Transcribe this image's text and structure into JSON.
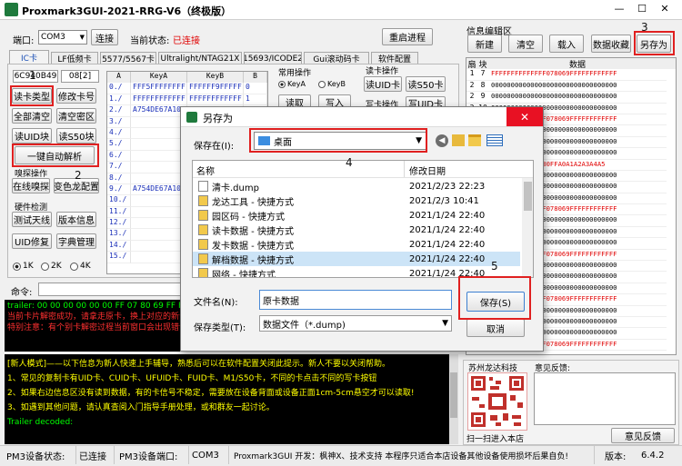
{
  "window": {
    "title": "Proxmark3GUI-2021-RRG-V6（终极版）",
    "min": "—",
    "max": "☐",
    "close": "✕"
  },
  "toolbar": {
    "port_label": "端口:",
    "port_value": "COM3",
    "connect": "连接",
    "state_label": "当前状态:",
    "state_value": "已连接",
    "restart": "重启进程"
  },
  "tabs": [
    "IC卡",
    "LF低频卡",
    "5577/5567卡",
    "Ultralight/NTAG21X",
    "15693/ICODE2",
    "Gui滚动码卡",
    "软件配置"
  ],
  "ic": {
    "uid": "6C940B49",
    "sak": "08[2]",
    "btn_read_type": "读卡类型",
    "btn_modify": "修改卡号",
    "btn_clear_all": "全部清空",
    "btn_clear_key": "清空密区",
    "btn_read_uid": "读UID块",
    "btn_read_s50": "读S50块",
    "btn_auto_parse": "一键自动解析",
    "sec_sniff": "嗅探操作",
    "btn_online_sniff": "在线嗅探",
    "btn_chameleon": "变色龙配置",
    "sec_hw": "硬件检测",
    "btn_test_antenna": "测试天线",
    "btn_version": "版本信息",
    "btn_uid_fix": "UID修复",
    "btn_dict": "字典管理",
    "radio_1k": "1K",
    "radio_2k": "2K",
    "radio_4k": "4K"
  },
  "keys_table": {
    "headers": [
      "A",
      "KeyA",
      "KeyB",
      "B"
    ],
    "rows": [
      [
        "0./",
        "FFF5FFFFFFFF",
        "FFFFFF9FFFFF",
        "0"
      ],
      [
        "1./",
        "FFFFFFFFFFFF",
        "FFFFFFFFFFFF",
        "1"
      ],
      [
        "2./",
        "A754DE67A10",
        "",
        "2"
      ],
      [
        "3./",
        "",
        "",
        "3"
      ],
      [
        "4./",
        "",
        "",
        "4"
      ],
      [
        "5./",
        "",
        "",
        "5"
      ],
      [
        "6./",
        "",
        "",
        "6"
      ],
      [
        "7./",
        "",
        "",
        "7"
      ],
      [
        "8./",
        "",
        "",
        "8"
      ],
      [
        "9./",
        "A754DE67A10",
        "",
        "9"
      ],
      [
        "10./",
        "",
        "",
        "10"
      ],
      [
        "11./",
        "",
        "",
        "11"
      ],
      [
        "12./",
        "",
        "",
        "12"
      ],
      [
        "13./",
        "",
        "",
        "13"
      ],
      [
        "14./",
        "",
        "",
        "14"
      ],
      [
        "15./",
        "",
        "",
        "15"
      ]
    ]
  },
  "common_ops": {
    "title": "常用操作",
    "keyA": "KeyA",
    "keyB": "KeyB",
    "read": "读取",
    "write": "写入",
    "card_ops_title": "读卡操作",
    "read_uid": "读UID卡",
    "read_s50": "读S50卡",
    "write_ops": "写卡操作",
    "write_uid": "写UID卡"
  },
  "info_editor": {
    "title": "信息编辑区",
    "new": "新建",
    "clear": "清空",
    "load": "载入",
    "collect": "数据收藏",
    "save_as": "另存为",
    "headers": [
      "扇",
      "块",
      "数据"
    ],
    "rows": [
      [
        "1",
        "7",
        "FFFFFFFFFFFFFF078069FFFFFFFFFFFF",
        "red"
      ],
      [
        "2",
        "8",
        "00000000000000000000000000000000",
        "black"
      ],
      [
        "2",
        "9",
        "00000000000000000000000000000000",
        "black"
      ],
      [
        "2",
        "10",
        "00000000000000000000000000000000",
        "black"
      ],
      [
        "2",
        "11",
        "FFFFFFFFFFFFFF078069FFFFFFFFFFFF",
        "red"
      ],
      [
        "3",
        "12",
        "00000000000000000000000000000000",
        "black"
      ],
      [
        "3",
        "13",
        "00000000000000000000000000000000",
        "black"
      ],
      [
        "3",
        "14",
        "00000000000000000000000000000000",
        "black"
      ],
      [
        "3",
        "15",
        "FFFFFFFFFFF0780FFA0A1A2A3A4A5",
        "red"
      ],
      [
        "4",
        "16",
        "00000000000000000000000000000000",
        "black"
      ],
      [
        "4",
        "17",
        "00000000000000000000000000000000",
        "black"
      ],
      [
        "4",
        "18",
        "00000000000000000000000000000000",
        "black"
      ],
      [
        "4",
        "19",
        "FFFFFFFFFFFFFF078069FFFFFFFFFFFF",
        "red"
      ],
      [
        "5",
        "20",
        "00000000000000000000000000000000",
        "black"
      ],
      [
        "5",
        "21",
        "00000000000000000000000000000000",
        "black"
      ],
      [
        "5",
        "22",
        "00000000000000000000000000000000",
        "black"
      ],
      [
        "5",
        "23",
        "FFFFFFFFFFFFFF078069FFFFFFFFFFFF",
        "red"
      ],
      [
        "6",
        "24",
        "00000000000000000000000000000000",
        "black"
      ],
      [
        "6",
        "25",
        "00000000000000000000000000000000",
        "black"
      ],
      [
        "6",
        "26",
        "00000000000000000000000000000000",
        "black"
      ],
      [
        "6",
        "27",
        "FFFFFFFFFFFFFF078069FFFFFFFFFFFF",
        "red"
      ],
      [
        "7",
        "28",
        "00000000000000000000000000000000",
        "black"
      ],
      [
        "7",
        "29",
        "00000000000000000000000000000000",
        "black"
      ],
      [
        "7",
        "30",
        "00000000000000000000000000000000",
        "black"
      ],
      [
        "7",
        "31",
        "FFFFFFFFFFFFFF078069FFFFFFFFFFFF",
        "red"
      ]
    ]
  },
  "command": {
    "label": "命令:",
    "send": "发送"
  },
  "console": {
    "lines": [
      {
        "t": "trailer: 00 00 00 00 00 00 FF 07 80 69 FF FF FF FF FF FF",
        "c": "#00ff00"
      },
      {
        "t": "当前卡片解密成功，请拿走原卡，换上对应的新卡操作",
        "c": "#ff3030"
      },
      {
        "t": "特别注意：有个别卡解密过程当前窗口会出现错误",
        "c": "#ff3030"
      }
    ],
    "lines2": [
      {
        "t": "[新人模式]——以下信息为新人快速上手辅导，熟悉后可以在软件配置关闭此提示。新人不要以关闭帮助。",
        "c": "#ffff00"
      },
      {
        "t": "1、常见的复制卡有UID卡、CUID卡、UFUID卡、FUID卡、M1/S50卡，不同的卡点击不同的写卡按钮",
        "c": "#ffff00"
      },
      {
        "t": "2、如果右边信息区没有读到数据，有的卡信号不稳定，需要放在设备背面或设备正面1cm-5cm悬空才可以读取!",
        "c": "#ffff00"
      },
      {
        "t": "3、如遇到其他问题，请认真查阅入门指导手册处理，或和群友一起讨论。",
        "c": "#ffff00"
      },
      {
        "t": "Trailer decoded:",
        "c": "#00ff00"
      }
    ]
  },
  "promo": {
    "brand": "苏州龙达科技",
    "feedback": "意见反馈:",
    "scan": "扫一扫进入本店",
    "feedback_btn": "意见反馈"
  },
  "status": {
    "dev_state_label": "PM3设备状态:",
    "dev_state": "已连接",
    "dev_port_label": "PM3设备端口:",
    "dev_port": "COM3",
    "about": "Proxmark3GUI 开发：枫神X、技术支持  本程序只适合本店设备其他设备使用损坏后果自负!",
    "ver_label": "版本:",
    "ver": "6.4.2"
  },
  "dialog": {
    "title": "另存为",
    "save_in_label": "保存在(I):",
    "save_in_value": "桌面",
    "col_name": "名称",
    "col_date": "修改日期",
    "files": [
      {
        "name": "清卡.dump",
        "date": "2021/2/23 22:23",
        "icon": "file"
      },
      {
        "name": "龙达工具 - 快捷方式",
        "date": "2021/2/3 10:41",
        "icon": "shortcut"
      },
      {
        "name": "园区码 - 快捷方式",
        "date": "2021/1/24 22:40",
        "icon": "shortcut"
      },
      {
        "name": "读卡数据 - 快捷方式",
        "date": "2021/1/24 22:40",
        "icon": "shortcut"
      },
      {
        "name": "发卡数据 - 快捷方式",
        "date": "2021/1/24 22:40",
        "icon": "shortcut"
      },
      {
        "name": "解档数据 - 快捷方式",
        "date": "2021/1/24 22:40",
        "icon": "shortcut"
      },
      {
        "name": "网络 - 快捷方式",
        "date": "2021/1/24 22:40",
        "icon": "shortcut"
      }
    ],
    "filename_label": "文件名(N):",
    "filename_value": "原卡数据",
    "filetype_label": "保存类型(T):",
    "filetype_value": "数据文件（*.dump)",
    "save": "保存(S)",
    "cancel": "取消"
  },
  "annotations": [
    "1",
    "2",
    "3",
    "4",
    "5"
  ]
}
